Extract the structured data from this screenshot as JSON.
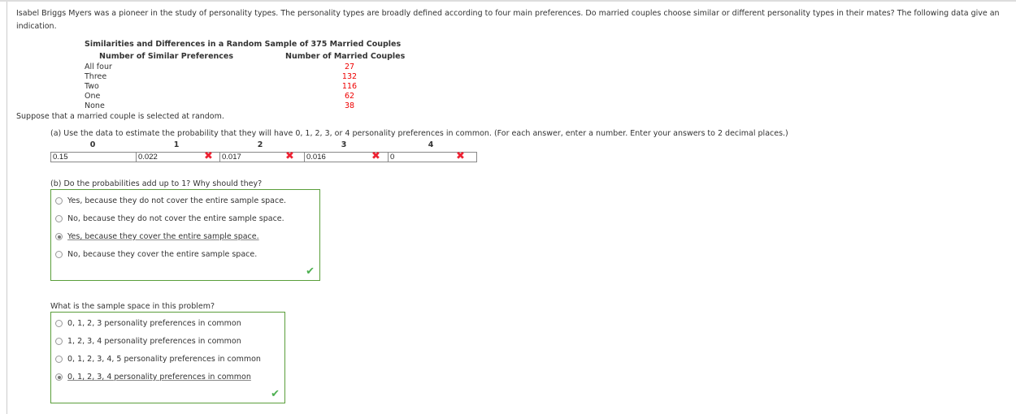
{
  "intro": "Isabel Briggs Myers was a pioneer in the study of personality types. The personality types are broadly defined according to four main preferences. Do married couples choose similar or different personality types in their mates? The following data give an indication.",
  "table": {
    "title": "Similarities and Differences in a Random Sample of 375 Married Couples",
    "col1_header": "Number of Similar Preferences",
    "col2_header": "Number of Married Couples",
    "rows": [
      {
        "label": "All four",
        "value": "27"
      },
      {
        "label": "Three",
        "value": "132"
      },
      {
        "label": "Two",
        "value": "116"
      },
      {
        "label": "One",
        "value": "62"
      },
      {
        "label": "None",
        "value": "38"
      }
    ]
  },
  "suppose": "Suppose that a married couple is selected at random.",
  "part_a": {
    "prompt": "(a) Use the data to estimate the probability that they will have 0, 1, 2, 3, or 4 personality preferences in common. (For each answer, enter a number. Enter your answers to 2 decimal places.)",
    "columns": [
      {
        "header": "0",
        "value": "0.15",
        "status": "incorrect"
      },
      {
        "header": "1",
        "value": "0.022",
        "status": "incorrect"
      },
      {
        "header": "2",
        "value": "0.017",
        "status": "incorrect"
      },
      {
        "header": "3",
        "value": "0.016",
        "status": "incorrect"
      },
      {
        "header": "4",
        "value": "0",
        "status": "incorrect"
      }
    ],
    "incorrect_icon": "✖"
  },
  "part_b": {
    "prompt": "(b) Do the probabilities add up to 1? Why should they?",
    "options": [
      "Yes, because they do not cover the entire sample space.",
      "No, because they do not cover the entire sample space.",
      "Yes, because they cover the entire sample space.",
      "No, because they cover the entire sample space."
    ],
    "selected_index": 2,
    "status": "correct"
  },
  "sample_space": {
    "prompt": "What is the sample space in this problem?",
    "options": [
      "0, 1, 2, 3 personality preferences in common",
      "1, 2, 3, 4 personality preferences in common",
      "0, 1, 2, 3, 4, 5 personality preferences in common",
      "0, 1, 2, 3, 4 personality preferences in common"
    ],
    "selected_index": 3,
    "status": "correct"
  },
  "correct_icon": "✔",
  "colors": {
    "incorrect": "#e22233",
    "correct": "#4caf50",
    "box_border": "#5a9e3a",
    "table_values": "#ee0000"
  }
}
